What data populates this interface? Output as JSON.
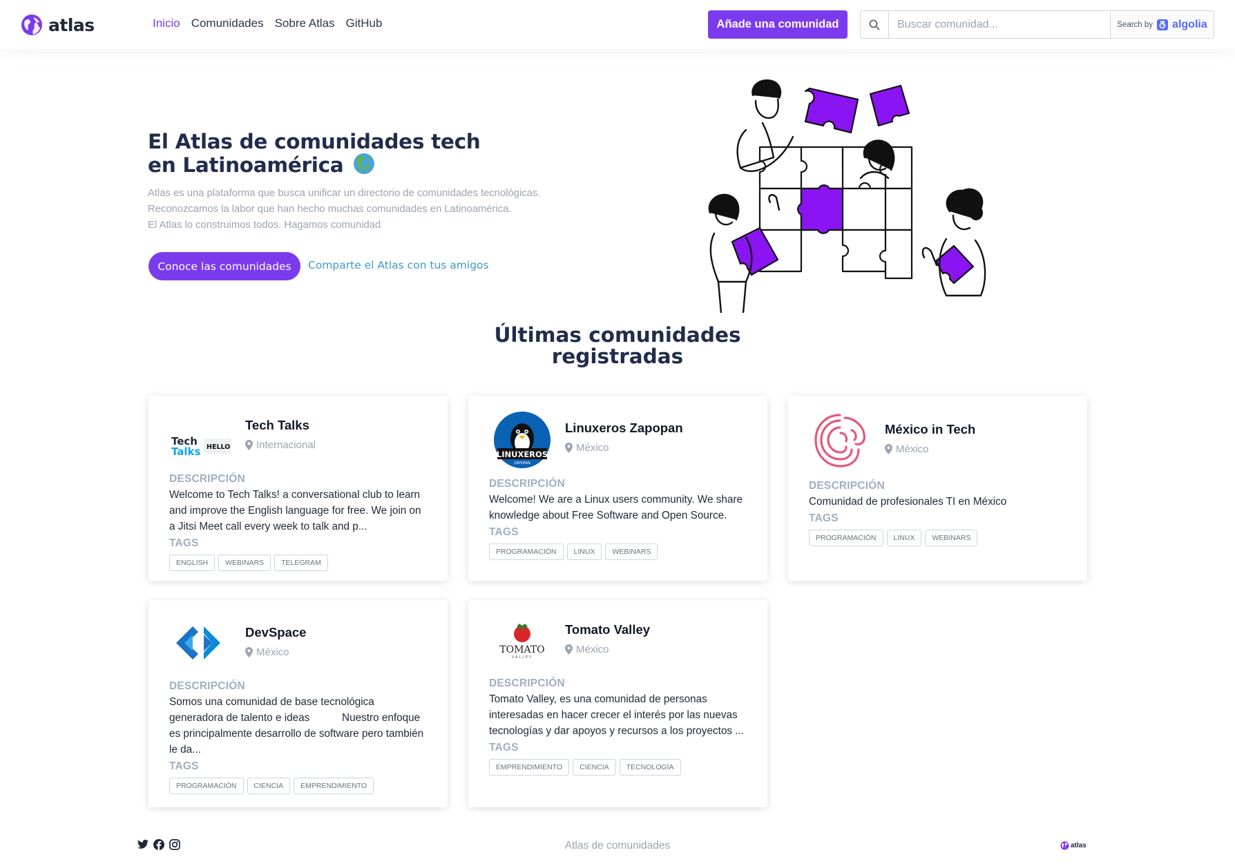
{
  "brand": {
    "name": "atlas",
    "accent": "#7c3aed"
  },
  "nav": {
    "items": [
      {
        "label": "Inicio",
        "active": true
      },
      {
        "label": "Comunidades",
        "active": false
      },
      {
        "label": "Sobre Atlas",
        "active": false
      },
      {
        "label": "GitHub",
        "active": false
      }
    ],
    "add_button": "Añade una comunidad"
  },
  "search": {
    "placeholder": "Buscar comunidad...",
    "powered_by": "Search by",
    "provider": "algolia",
    "icon": "search-icon"
  },
  "hero": {
    "title_line1": "El Atlas de comunidades tech",
    "title_line2": "en Latinoamérica",
    "title_emoji": "globe-americas-icon",
    "description": [
      "Atlas es una plataforma que busca unificar un directorio de comunidades tecnológicas.",
      "Reconozcamos la labor que han hecho muchas comunidades en Latinoamérica.",
      "El Atlas lo construimos todos. Hagamos comunidad"
    ],
    "cta_button": "Conoce las comunidades",
    "share_link": "Comparte el Atlas con tus amigos"
  },
  "section": {
    "title_line1": "Últimas comunidades",
    "title_line2": "registradas"
  },
  "labels": {
    "description": "DESCRIPCIÓN",
    "tags": "TAGS"
  },
  "communities": [
    {
      "name": "Tech Talks",
      "location": "Internacional",
      "logo": "tech-talks-logo",
      "logo_text": [
        "Tech",
        "Talks",
        "HELLO"
      ],
      "description": "Welcome to Tech Talks! a conversational club to learn and improve the English language for free. We join on a Jitsi Meet call every week to talk and p...",
      "tags": [
        "ENGLISH",
        "WEBINARS",
        "TELEGRAM"
      ]
    },
    {
      "name": "Linuxeros Zapopan",
      "location": "México",
      "logo": "linuxeros-logo",
      "logo_text": [
        "LINUXEROS",
        "ZAPOPAN"
      ],
      "description": "Welcome! We are a Linux users community. We share knowledge about Free Software and Open Source.",
      "tags": [
        "PROGRAMACIÓN",
        "LINUX",
        "WEBINARS"
      ]
    },
    {
      "name": "México in Tech",
      "location": "México",
      "logo": "mexico-in-tech-logo",
      "description": "Comunidad de profesionales TI en México",
      "tags": [
        "PROGRAMACIÓN",
        "LINUX",
        "WEBINARS"
      ]
    },
    {
      "name": "DevSpace",
      "location": "México",
      "logo": "devspace-logo",
      "description": "Somos una comunidad de base tecnológica generadora de talento e ideas           Nuestro enfoque es principalmente desarrollo de software pero también le da...",
      "tags": [
        "PROGRAMACIÓN",
        "CIENCIA",
        "EMPRENDIMIENTO"
      ]
    },
    {
      "name": "Tomato Valley",
      "location": "México",
      "logo": "tomato-valley-logo",
      "logo_text": [
        "TOMATO",
        "VALLEY"
      ],
      "description": "Tomato Valley, es una comunidad de personas interesadas en hacer crecer el interés por las nuevas tecnologías y dar apoyos y recursos a los proyectos ...",
      "tags": [
        "EMPRENDIMIENTO",
        "CIENCIA",
        "TECNOLOGÍA"
      ]
    }
  ],
  "footer": {
    "text": "Atlas de comunidades",
    "social": [
      "twitter-icon",
      "facebook-icon",
      "instagram-icon"
    ],
    "logo_text": "atlas"
  },
  "colors": {
    "accent": "#7c3aed",
    "title": "#222c4c",
    "muted": "#9ca3af",
    "link": "#3d9ac7",
    "algolia": "#5468ff"
  }
}
